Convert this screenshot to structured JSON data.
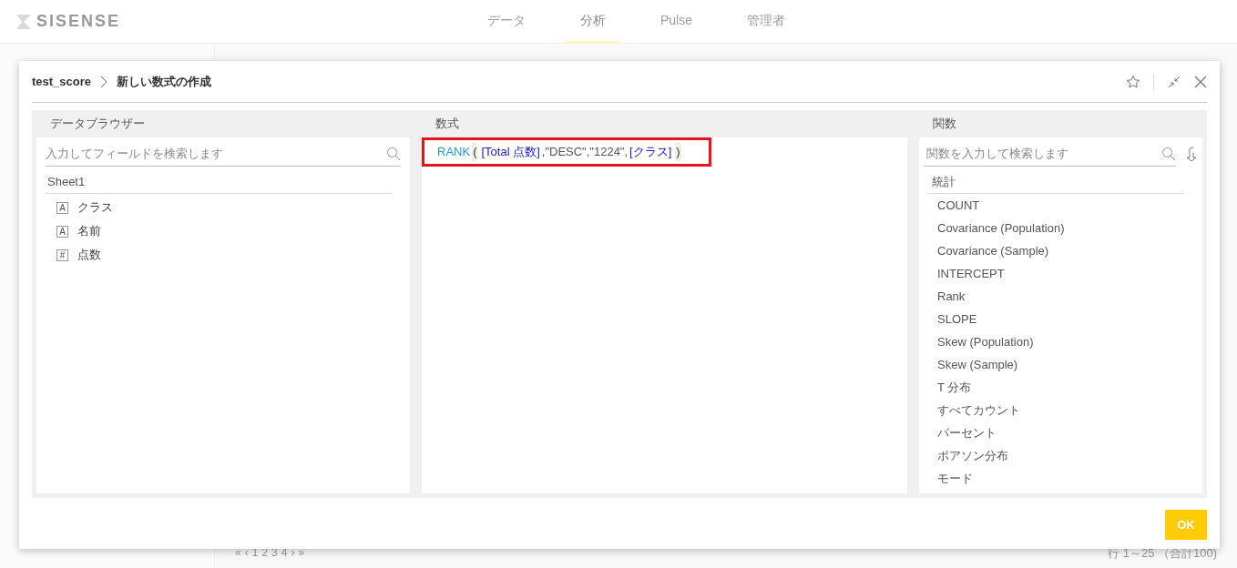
{
  "app": {
    "logo": "SISENSE",
    "nav": [
      {
        "label": "データ",
        "selected": false
      },
      {
        "label": "分析",
        "selected": true
      },
      {
        "label": "Pulse",
        "selected": false
      },
      {
        "label": "管理者",
        "selected": false
      }
    ],
    "pager": [
      "«",
      "‹",
      "1",
      "2",
      "3",
      "4",
      "›",
      "»"
    ],
    "row_info": "行 1～25 （合計100)"
  },
  "dialog": {
    "breadcrumb": [
      "test_score",
      "新しい数式の作成"
    ],
    "data_browser": {
      "title": "データブラウザー",
      "search": {
        "placeholder": "入力してフィールドを検索します"
      },
      "table": "Sheet1",
      "fields": [
        {
          "type": "A",
          "name": "クラス"
        },
        {
          "type": "A",
          "name": "名前"
        },
        {
          "type": "#",
          "name": "点数"
        }
      ]
    },
    "formula": {
      "title": "数式",
      "highlighted": true,
      "tokens": [
        {
          "kind": "function",
          "text": "RANK"
        },
        {
          "kind": "paren",
          "text": "("
        },
        {
          "kind": "field",
          "text": "[Total 点数]"
        },
        {
          "kind": "plain",
          "text": ",\"DESC\",\"1224\","
        },
        {
          "kind": "field",
          "text": "[クラス]"
        },
        {
          "kind": "paren",
          "text": ")"
        }
      ]
    },
    "functions": {
      "title": "関数",
      "search": {
        "placeholder": "関数を入力して検索します"
      },
      "category": "統計",
      "items": [
        "COUNT",
        "Covariance (Population)",
        "Covariance (Sample)",
        "INTERCEPT",
        "Rank",
        "SLOPE",
        "Skew (Population)",
        "Skew (Sample)",
        "T 分布",
        "すべてカウント",
        "パーセント",
        "ポアソン分布",
        "モード"
      ]
    },
    "ok": "OK"
  }
}
